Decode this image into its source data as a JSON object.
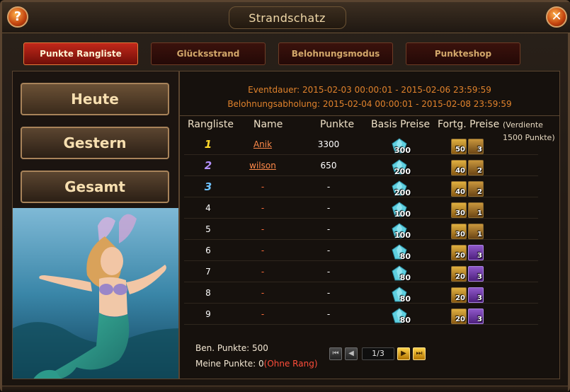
{
  "window": {
    "title": "Strandschatz",
    "help_label": "?",
    "close_label": "✕"
  },
  "tabs": [
    {
      "label": "Punkte Rangliste",
      "active": true
    },
    {
      "label": "Glücksstrand",
      "active": false
    },
    {
      "label": "Belohnungsmodus",
      "active": false
    },
    {
      "label": "Punkteshop",
      "active": false
    }
  ],
  "sidebar": {
    "buttons": [
      {
        "label": "Heute"
      },
      {
        "label": "Gestern"
      },
      {
        "label": "Gesamt"
      }
    ]
  },
  "event": {
    "duration": "Eventdauer: 2015-02-03 00:00:01 - 2015-02-06 23:59:59",
    "claim": "Belohnungsabholung: 2015-02-04 00:00:01 - 2015-02-08 23:59:59"
  },
  "table": {
    "headers": {
      "rank": "Rangliste",
      "name": "Name",
      "points": "Punkte",
      "basis": "Basis Preise",
      "fortg": "Fortg. Preise"
    },
    "earned_note": "(Verdiente 1500 Punkte)",
    "rows": [
      {
        "rank": "1",
        "name": "Anik",
        "points": "3300",
        "basis": "300",
        "chest": "50",
        "scroll": "3"
      },
      {
        "rank": "2",
        "name": "wilson",
        "points": "650",
        "basis": "200",
        "chest": "40",
        "scroll": "2"
      },
      {
        "rank": "3",
        "name": "-",
        "points": "-",
        "basis": "200",
        "chest": "40",
        "scroll": "2"
      },
      {
        "rank": "4",
        "name": "-",
        "points": "-",
        "basis": "100",
        "chest": "30",
        "scroll": "1"
      },
      {
        "rank": "5",
        "name": "-",
        "points": "-",
        "basis": "100",
        "chest": "30",
        "scroll": "1"
      },
      {
        "rank": "6",
        "name": "-",
        "points": "-",
        "basis": "80",
        "chest": "20",
        "scroll": "3"
      },
      {
        "rank": "7",
        "name": "-",
        "points": "-",
        "basis": "80",
        "chest": "20",
        "scroll": "3"
      },
      {
        "rank": "8",
        "name": "-",
        "points": "-",
        "basis": "80",
        "chest": "20",
        "scroll": "3"
      },
      {
        "rank": "9",
        "name": "-",
        "points": "-",
        "basis": "80",
        "chest": "20",
        "scroll": "3"
      }
    ]
  },
  "footer": {
    "required_points": "Ben. Punkte: 500",
    "my_points": "Meine Punkte: 0",
    "no_rank": "(Ohne Rang)"
  },
  "pager": {
    "page": "1/3",
    "first_label": "⏮",
    "prev_label": "◀",
    "next_label": "▶",
    "last_label": "⏭"
  },
  "colors": {
    "accent_orange": "#e0822c",
    "active_tab": "#c2281a",
    "rank_gold": "#ffd92b",
    "rank_purple": "#b592ff",
    "rank_blue": "#6fc3ff"
  }
}
